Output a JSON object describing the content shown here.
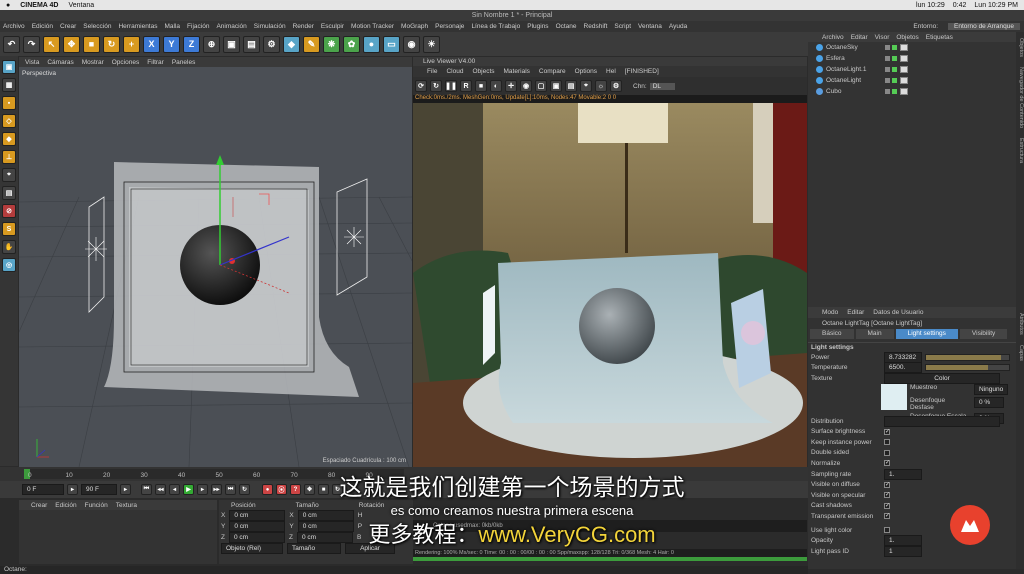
{
  "mac_menu": {
    "apple": "",
    "app": "CINEMA 4D",
    "items": [
      "Ventana"
    ],
    "right": [
      "lun 10:29",
      "0:42",
      "Lun 10:29 PM"
    ]
  },
  "window_title": "Sin Nombre 1 * - Principal",
  "menu": [
    "Archivo",
    "Edición",
    "Crear",
    "Selección",
    "Herramientas",
    "Malla",
    "Fijación",
    "Animación",
    "Simulación",
    "Render",
    "Esculpir",
    "Motion Tracker",
    "MoGraph",
    "Personaje",
    "Línea de Trabajo",
    "Plugins",
    "Octane",
    "Redshift",
    "Script",
    "Ventana",
    "Ayuda"
  ],
  "entorno": {
    "label": "Entorno:",
    "value": "Entorno de Arranque"
  },
  "viewport": {
    "menu": [
      "Vista",
      "Cámaras",
      "Mostrar",
      "Opciones",
      "Filtrar",
      "Paneles"
    ],
    "label": "Perspectiva",
    "grid": "Espaciado Cuadrícula : 100 cm"
  },
  "live_viewer": {
    "title": "Live Viewer V4.00",
    "menu": [
      "File",
      "Cloud",
      "Objects",
      "Materials",
      "Compare",
      "Options",
      "Hel",
      "[FINISHED]"
    ],
    "chn_label": "Chn:",
    "chn_value": "DL",
    "status": "Check:0ms./2ms. MeshGen:0ms, Update[L]:10ms, Nodes:47 Movable:2  0 0"
  },
  "timeline": {
    "ticks": [
      "0",
      "10",
      "20",
      "30",
      "40",
      "50",
      "60",
      "70",
      "80",
      "90"
    ],
    "end": "0 F"
  },
  "transport": {
    "start": "0 F",
    "end": "90 F"
  },
  "materials": {
    "menu": [
      "Crear",
      "Edición",
      "Función",
      "Textura"
    ]
  },
  "coords": {
    "headers": [
      "Posición",
      "Tamaño",
      "Rotación"
    ],
    "rows": [
      {
        "axis": "X",
        "pos": "0 cm",
        "size": "0 cm",
        "rot": "H"
      },
      {
        "axis": "Y",
        "pos": "0 cm",
        "size": "0 cm",
        "rot": "P"
      },
      {
        "axis": "Z",
        "pos": "0 cm",
        "size": "0 cm",
        "rot": "B"
      }
    ],
    "mode": "Objeto (Rel)",
    "size_mode": "Tamaño",
    "apply": "Aplicar"
  },
  "object_manager": {
    "menu": [
      "Archivo",
      "Editar",
      "Visor",
      "Objetos",
      "Etiquetas"
    ],
    "objects": [
      {
        "name": "OctaneSky",
        "color": "#4aa3e8"
      },
      {
        "name": "Esfera",
        "color": "#4aa3e8"
      },
      {
        "name": "OctaneLight.1",
        "color": "#4aa3e8"
      },
      {
        "name": "OctaneLight",
        "color": "#4aa3e8"
      },
      {
        "name": "Cubo",
        "color": "#5a9de0"
      }
    ]
  },
  "attributes": {
    "menu": [
      "Modo",
      "Editar",
      "Datos de Usuario"
    ],
    "title": "Octane LightTag [Octane LightTag]",
    "tabs": [
      "Básico",
      "Main",
      "Light settings",
      "Visibility"
    ],
    "section": "Light settings",
    "power_label": "Power",
    "power": "8.733282",
    "power_fraction": 0.9,
    "temperature_label": "Temperature",
    "temperature": "6500.",
    "temperature_fraction": 0.75,
    "texture_label": "Texture",
    "texture_btn": "Color",
    "muestreo": "Muestreo",
    "ninguno": "Ninguno",
    "desfase": "Desenfoque Desfase",
    "desfase_val": "0 %",
    "escala": "Desenfoque Escala",
    "escala_val": "0 %",
    "distribution_label": "Distribution",
    "checks": [
      {
        "label": "Surface brightness",
        "value": "✓"
      },
      {
        "label": "Keep instance power",
        "value": ""
      },
      {
        "label": "Double sided",
        "value": ""
      },
      {
        "label": "Normalize",
        "value": "✓"
      }
    ],
    "sampling_label": "Sampling rate",
    "sampling": "1.",
    "checks2": [
      {
        "label": "Visible on diffuse",
        "value": "✓"
      },
      {
        "label": "Visible on specular",
        "value": "✓"
      },
      {
        "label": "Cast shadows",
        "value": "✓"
      },
      {
        "label": "Transparent emission",
        "value": "✓"
      }
    ],
    "use_light_color": "Use light color",
    "opacity_label": "Opacity",
    "opacity": "1.",
    "pass_label": "Light pass ID",
    "pass": "1"
  },
  "render_stats": "Rendering: 100%  Ms/sec: 0  Time: 00 : 00 : 00/00 : 00 : 00  Spp/maxspp: 128/128  Tri: 0/368  Mesh: 4  Hair: 0",
  "gpu_stats": "Octane usedmax: 0kb/0kb",
  "right_tabs": [
    "Objetos",
    "Navegador de Contenido",
    "Estructura"
  ],
  "right_tabs2": [
    "Atributos",
    "Capas"
  ],
  "status_bar": "Octane:",
  "subtitles": {
    "zh": "这就是我们创建第一个场景的方式",
    "es": "es como creamos nuestra primera escena",
    "ad_prefix": "更多教程：",
    "ad_url": "www.VeryCG.com"
  }
}
